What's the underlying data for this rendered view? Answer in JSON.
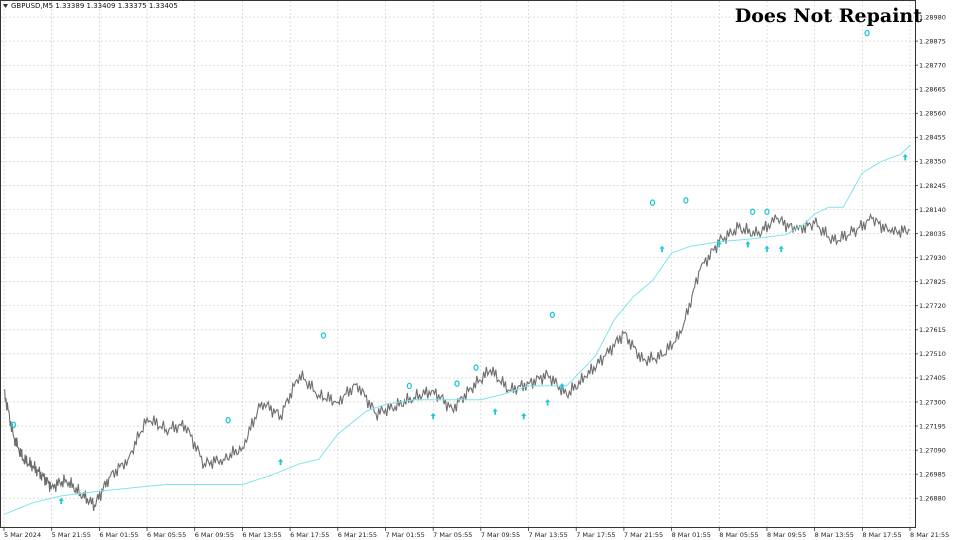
{
  "header": {
    "symbol_text": "GBPUSD,M5  1.33389 1.33409 1.33375 1.33405",
    "menu_icon": "triangle-down-icon"
  },
  "overlay_title": "Does Not Repaint",
  "colors": {
    "price": "#6e6e6e",
    "indicator": "#7fe3ef",
    "arrow": "#1fc7d6",
    "grid": "#c8c8c8",
    "axis": "#333333"
  },
  "chart_data": {
    "type": "line",
    "title": "Does Not Repaint",
    "xlabel": "",
    "ylabel": "",
    "ylim": [
      1.2675,
      1.2905
    ],
    "y_ticks": [
      "1.28980",
      "1.28875",
      "1.28770",
      "1.28665",
      "1.28560",
      "1.28455",
      "1.28350",
      "1.28245",
      "1.28140",
      "1.28035",
      "1.27930",
      "1.27825",
      "1.27720",
      "1.27615",
      "1.27510",
      "1.27405",
      "1.27300",
      "1.27195",
      "1.27090",
      "1.26985",
      "1.26880"
    ],
    "x_ticks": [
      "5 Mar 2024",
      "5 Mar 21:55",
      "6 Mar 01:55",
      "6 Mar 05:55",
      "6 Mar 09:55",
      "6 Mar 13:55",
      "6 Mar 17:55",
      "6 Mar 21:55",
      "7 Mar 01:55",
      "7 Mar 05:55",
      "7 Mar 09:55",
      "7 Mar 13:55",
      "7 Mar 17:55",
      "7 Mar 21:55",
      "8 Mar 01:55",
      "8 Mar 05:55",
      "8 Mar 09:55",
      "8 Mar 13:55",
      "8 Mar 17:55",
      "8 Mar 21:55"
    ],
    "grid": true,
    "series": [
      {
        "key": "price",
        "x": [
          0,
          0.2,
          0.4,
          0.6,
          0.8,
          1,
          1.3,
          1.6,
          1.9,
          2.2,
          2.6,
          3,
          3.4,
          3.8,
          4.2,
          4.6,
          5,
          5.4,
          5.8,
          6.2,
          6.6,
          7,
          7.4,
          7.8,
          8.2,
          8.6,
          9,
          9.4,
          9.8,
          10.2,
          10.6,
          11,
          11.4,
          11.8,
          12.2,
          12.6,
          13,
          13.4,
          13.8,
          14.2,
          14.6,
          15,
          15.4,
          15.8,
          16.2,
          16.6,
          17,
          17.4,
          17.8,
          18.2,
          18.6,
          19
        ],
        "y": [
          1.2735,
          1.2715,
          1.2705,
          1.2702,
          1.2698,
          1.2693,
          1.2696,
          1.269,
          1.2685,
          1.2697,
          1.2705,
          1.2723,
          1.2718,
          1.272,
          1.2703,
          1.2705,
          1.271,
          1.273,
          1.2724,
          1.2742,
          1.2733,
          1.273,
          1.2738,
          1.2725,
          1.2728,
          1.2732,
          1.2735,
          1.2727,
          1.2736,
          1.2744,
          1.2735,
          1.2738,
          1.2742,
          1.2733,
          1.2741,
          1.275,
          1.276,
          1.2748,
          1.275,
          1.276,
          1.2788,
          1.28,
          1.2806,
          1.2803,
          1.281,
          1.2805,
          1.2808,
          1.28,
          1.2804,
          1.281,
          1.2804,
          1.2805
        ]
      },
      {
        "key": "indicator",
        "x": [
          0,
          0.6,
          1.2,
          2,
          2.9,
          3.4,
          4.2,
          5,
          5.6,
          6.2,
          6.6,
          7,
          7.6,
          8,
          8.6,
          9,
          9.5,
          10,
          10.4,
          11,
          11.4,
          11.8,
          12.4,
          12.8,
          13.2,
          13.6,
          14,
          14.4,
          15,
          15.6,
          16,
          16.4,
          16.8,
          17,
          17.3,
          17.6,
          18,
          18.4,
          18.8,
          19
        ],
        "y": [
          1.2681,
          1.2686,
          1.2689,
          1.2691,
          1.2693,
          1.2694,
          1.2694,
          1.2694,
          1.2698,
          1.2703,
          1.2705,
          1.2716,
          1.2726,
          1.2729,
          1.2731,
          1.2731,
          1.2731,
          1.2731,
          1.2733,
          1.2737,
          1.2737,
          1.2737,
          1.275,
          1.2766,
          1.2776,
          1.2783,
          1.2795,
          1.2798,
          1.28,
          1.2801,
          1.2802,
          1.2803,
          1.2808,
          1.2812,
          1.2815,
          1.2815,
          1.283,
          1.2835,
          1.2838,
          1.2842
        ]
      }
    ],
    "up_arrows": [
      {
        "x": 1.2,
        "y": 1.269
      },
      {
        "x": 5.8,
        "y": 1.2707
      },
      {
        "x": 9.0,
        "y": 1.2727
      },
      {
        "x": 10.3,
        "y": 1.2729
      },
      {
        "x": 10.9,
        "y": 1.2727
      },
      {
        "x": 11.4,
        "y": 1.2733
      },
      {
        "x": 11.7,
        "y": 1.274
      },
      {
        "x": 13.8,
        "y": 1.28
      },
      {
        "x": 15.0,
        "y": 1.2802
      },
      {
        "x": 15.6,
        "y": 1.2802
      },
      {
        "x": 16.0,
        "y": 1.28
      },
      {
        "x": 16.3,
        "y": 1.28
      },
      {
        "x": 18.9,
        "y": 1.284
      }
    ],
    "circle_marks": [
      {
        "x": 0.2,
        "y": 1.272
      },
      {
        "x": 4.7,
        "y": 1.2722
      },
      {
        "x": 6.7,
        "y": 1.2759
      },
      {
        "x": 8.5,
        "y": 1.2737
      },
      {
        "x": 9.5,
        "y": 1.2738
      },
      {
        "x": 9.9,
        "y": 1.2745
      },
      {
        "x": 11.5,
        "y": 1.2768
      },
      {
        "x": 13.6,
        "y": 1.2817
      },
      {
        "x": 14.3,
        "y": 1.2818
      },
      {
        "x": 15.7,
        "y": 1.2813
      },
      {
        "x": 16.0,
        "y": 1.2813
      },
      {
        "x": 18.1,
        "y": 1.2891
      }
    ]
  }
}
